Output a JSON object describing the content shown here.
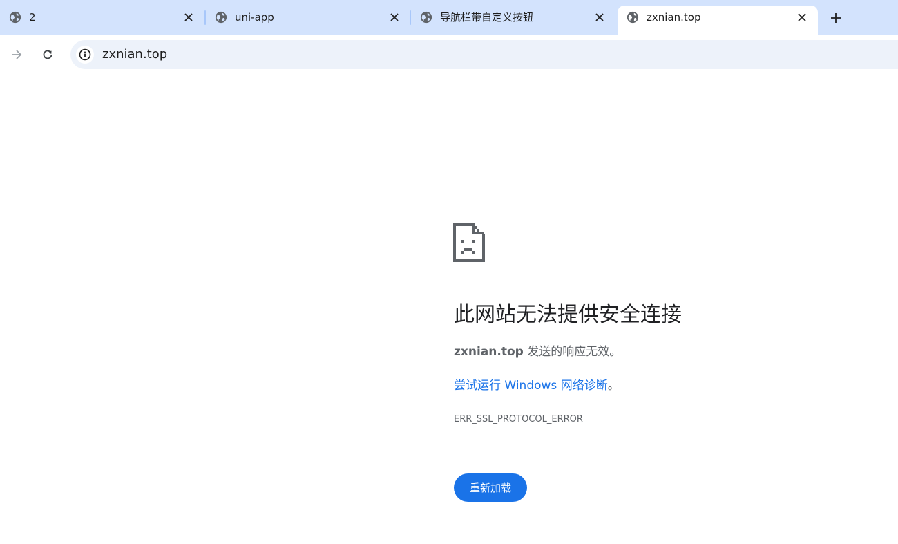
{
  "tabs": [
    {
      "title": "2",
      "icon": "globe-icon",
      "active": false
    },
    {
      "title": "uni-app",
      "icon": "globe-icon",
      "active": false
    },
    {
      "title": "导航栏带自定义按钮",
      "icon": "globe-icon",
      "active": false
    },
    {
      "title": "zxnian.top",
      "icon": "globe-icon",
      "active": true
    }
  ],
  "toolbar": {
    "url": "zxnian.top"
  },
  "error": {
    "heading": "此网站无法提供安全连接",
    "host": "zxnian.top",
    "description": "发送的响应无效。",
    "link_text": "尝试运行 Windows 网络诊断",
    "link_suffix": "。",
    "code": "ERR_SSL_PROTOCOL_ERROR",
    "reload_label": "重新加载"
  },
  "colors": {
    "tabstrip": "#d3e3fd",
    "accent": "#1a73e8",
    "omnibox": "#edf2fa"
  }
}
